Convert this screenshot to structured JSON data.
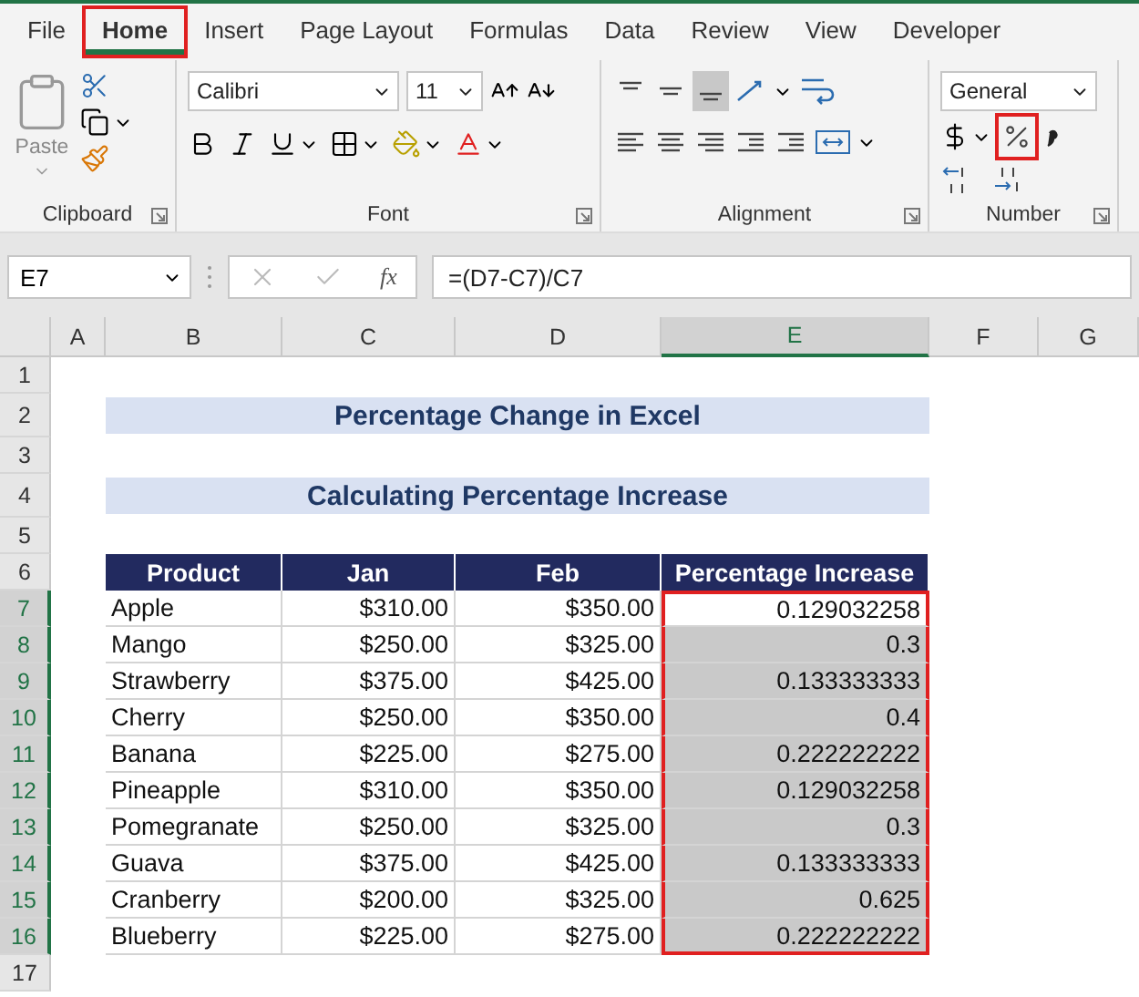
{
  "menu_tabs": [
    {
      "label": "File",
      "selected": false,
      "highlighted": false
    },
    {
      "label": "Home",
      "selected": true,
      "highlighted": true
    },
    {
      "label": "Insert",
      "selected": false,
      "highlighted": false
    },
    {
      "label": "Page Layout",
      "selected": false,
      "highlighted": false
    },
    {
      "label": "Formulas",
      "selected": false,
      "highlighted": false
    },
    {
      "label": "Data",
      "selected": false,
      "highlighted": false
    },
    {
      "label": "Review",
      "selected": false,
      "highlighted": false
    },
    {
      "label": "View",
      "selected": false,
      "highlighted": false
    },
    {
      "label": "Developer",
      "selected": false,
      "highlighted": false
    }
  ],
  "ribbon": {
    "clipboard": {
      "label": "Clipboard",
      "paste_label": "Paste"
    },
    "font": {
      "label": "Font",
      "font_name": "Calibri",
      "font_size": "11"
    },
    "alignment": {
      "label": "Alignment"
    },
    "number": {
      "label": "Number",
      "format": "General",
      "percent_highlighted": true
    }
  },
  "formula_bar": {
    "name_box": "E7",
    "function_label": "fx",
    "formula": "=(D7-C7)/C7"
  },
  "sheet": {
    "columns": [
      {
        "label": "A",
        "selected": false
      },
      {
        "label": "B",
        "selected": false
      },
      {
        "label": "C",
        "selected": false
      },
      {
        "label": "D",
        "selected": false
      },
      {
        "label": "E",
        "selected": true
      },
      {
        "label": "F",
        "selected": false
      },
      {
        "label": "G",
        "selected": false
      }
    ],
    "rows": [
      {
        "number": "1",
        "kind": "blank",
        "selected": false
      },
      {
        "number": "2",
        "kind": "title",
        "selected": false,
        "text": "Percentage Change in Excel"
      },
      {
        "number": "3",
        "kind": "blank",
        "selected": false
      },
      {
        "number": "4",
        "kind": "title",
        "selected": false,
        "text": "Calculating Percentage Increase"
      },
      {
        "number": "5",
        "kind": "blank",
        "selected": false
      },
      {
        "number": "6",
        "kind": "header",
        "selected": false,
        "cells": [
          "Product",
          "Jan",
          "Feb",
          "Percentage Increase"
        ]
      },
      {
        "number": "7",
        "kind": "data",
        "selected": true,
        "active": true,
        "outlined": true,
        "cells": [
          "Apple",
          "$310.00",
          "$350.00",
          "0.129032258"
        ]
      },
      {
        "number": "8",
        "kind": "data",
        "selected": true,
        "active": false,
        "outlined": true,
        "cells": [
          "Mango",
          "$250.00",
          "$325.00",
          "0.3"
        ]
      },
      {
        "number": "9",
        "kind": "data",
        "selected": true,
        "active": false,
        "outlined": true,
        "cells": [
          "Strawberry",
          "$375.00",
          "$425.00",
          "0.133333333"
        ]
      },
      {
        "number": "10",
        "kind": "data",
        "selected": true,
        "active": false,
        "outlined": true,
        "cells": [
          "Cherry",
          "$250.00",
          "$350.00",
          "0.4"
        ]
      },
      {
        "number": "11",
        "kind": "data",
        "selected": true,
        "active": false,
        "outlined": true,
        "cells": [
          "Banana",
          "$225.00",
          "$275.00",
          "0.222222222"
        ]
      },
      {
        "number": "12",
        "kind": "data",
        "selected": true,
        "active": false,
        "outlined": true,
        "cells": [
          "Pineapple",
          "$310.00",
          "$350.00",
          "0.129032258"
        ]
      },
      {
        "number": "13",
        "kind": "data",
        "selected": true,
        "active": false,
        "outlined": true,
        "cells": [
          "Pomegranate",
          "$250.00",
          "$325.00",
          "0.3"
        ]
      },
      {
        "number": "14",
        "kind": "data",
        "selected": true,
        "active": false,
        "outlined": true,
        "cells": [
          "Guava",
          "$375.00",
          "$425.00",
          "0.133333333"
        ]
      },
      {
        "number": "15",
        "kind": "data",
        "selected": true,
        "active": false,
        "outlined": true,
        "cells": [
          "Cranberry",
          "$200.00",
          "$325.00",
          "0.625"
        ]
      },
      {
        "number": "16",
        "kind": "data",
        "selected": true,
        "active": false,
        "outlined": true,
        "cells": [
          "Blueberry",
          "$225.00",
          "$275.00",
          "0.222222222"
        ]
      },
      {
        "number": "17",
        "kind": "blank",
        "selected": false
      }
    ]
  }
}
